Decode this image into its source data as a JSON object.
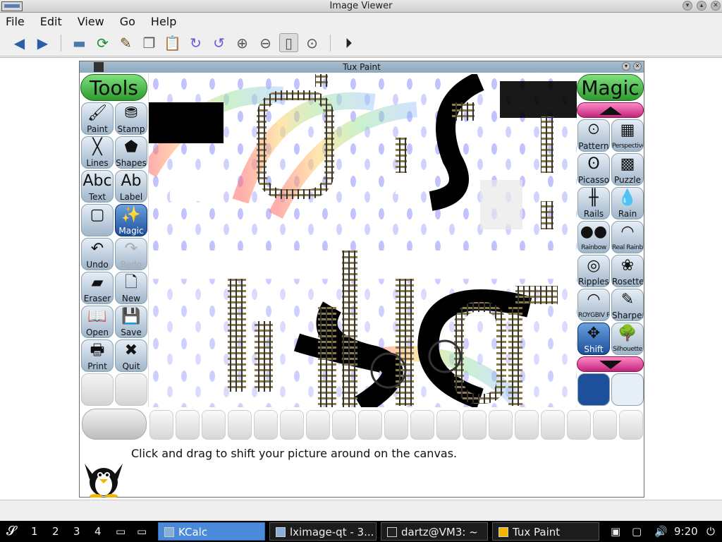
{
  "window": {
    "title": "Image Viewer"
  },
  "menu": [
    "File",
    "Edit",
    "View",
    "Go",
    "Help"
  ],
  "toolbar_icons": [
    "back-icon",
    "forward-icon",
    "open-folder-icon",
    "reload-icon",
    "edit-icon",
    "copy-icon",
    "paste-icon",
    "rotate-cw-icon",
    "rotate-ccw-icon",
    "zoom-in-icon",
    "zoom-out-icon",
    "fit-icon",
    "original-size-icon",
    "slideshow-icon"
  ],
  "tuxpaint": {
    "title": "Tux Paint",
    "tools_header": "Tools",
    "magic_header": "Magic",
    "tools": [
      {
        "label": "Paint",
        "glyph": "🖌"
      },
      {
        "label": "Stamp",
        "glyph": "⛃"
      },
      {
        "label": "Lines",
        "glyph": "╳"
      },
      {
        "label": "Shapes",
        "glyph": "⬟"
      },
      {
        "label": "Text",
        "glyph": "Abc"
      },
      {
        "label": "Label",
        "glyph": "Ab"
      },
      {
        "label": "",
        "glyph": "▢"
      },
      {
        "label": "Magic",
        "glyph": "✨"
      },
      {
        "label": "Undo",
        "glyph": "↶"
      },
      {
        "label": "Redo",
        "glyph": "↷"
      },
      {
        "label": "Eraser",
        "glyph": "▰"
      },
      {
        "label": "New",
        "glyph": "🗋"
      },
      {
        "label": "Open",
        "glyph": "📖"
      },
      {
        "label": "Save",
        "glyph": "💾"
      },
      {
        "label": "Print",
        "glyph": "🖶"
      },
      {
        "label": "Quit",
        "glyph": "✖"
      }
    ],
    "magic_tools": [
      {
        "label": "Pattern",
        "glyph": "ꖴ"
      },
      {
        "label": "Perspective",
        "glyph": "▦"
      },
      {
        "label": "Picasso",
        "glyph": "ʘ"
      },
      {
        "label": "Puzzle",
        "glyph": "▩"
      },
      {
        "label": "Rails",
        "glyph": "╫"
      },
      {
        "label": "Rain",
        "glyph": "💧"
      },
      {
        "label": "Rainbow",
        "glyph": "●●"
      },
      {
        "label": "Real Rainbow",
        "glyph": "◠"
      },
      {
        "label": "Ripples",
        "glyph": "◎"
      },
      {
        "label": "Rosette",
        "glyph": "❀"
      },
      {
        "label": "ROYGBIV Rainbow",
        "glyph": "◠"
      },
      {
        "label": "Sharpen",
        "glyph": "✎"
      },
      {
        "label": "Shift",
        "glyph": "✥"
      },
      {
        "label": "Silhouette",
        "glyph": "🌳"
      }
    ],
    "tip": "Click and drag to shift your picture around on the canvas."
  },
  "taskbar": {
    "desktops": [
      "1",
      "2",
      "3",
      "4"
    ],
    "tasks": [
      "KCalc",
      "lximage-qt - 3...",
      "dartz@VM3: ~",
      "Tux Paint"
    ],
    "clock": "9:20"
  }
}
